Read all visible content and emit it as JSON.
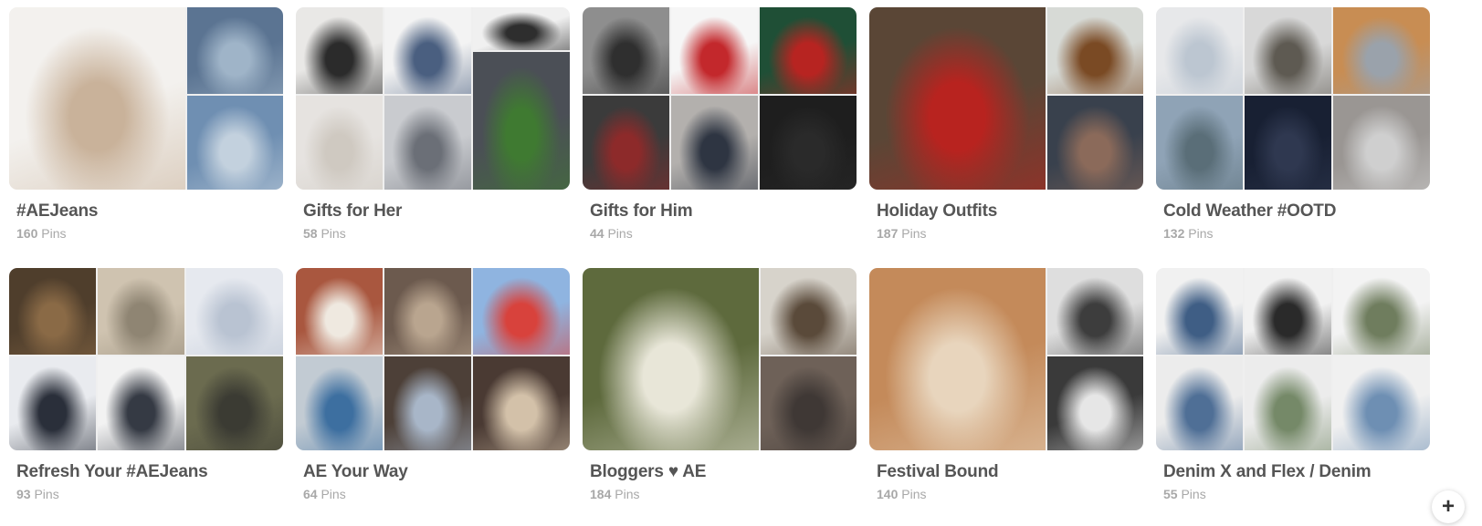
{
  "boards": [
    {
      "title": "#AEJeans",
      "count": "160",
      "unit": "Pins",
      "layout": "big",
      "tiles": [
        [
          "#f3f1ee",
          "#c9b29a"
        ],
        [
          "#5b7492",
          "#9fb4c8"
        ],
        [
          "#6f8fb2",
          "#c3d1de"
        ]
      ]
    },
    {
      "title": "Gifts for Her",
      "count": "58",
      "unit": "Pins",
      "layout": "grid",
      "tiles": [
        [
          "#e9e8e6",
          "#2b2b2b"
        ],
        [
          "#f3f3f3",
          "#4a5f80"
        ],
        [
          "#f0f0f0",
          "#2e2e2e"
        ],
        [
          "#e6e3e0",
          "#cfc9c1"
        ],
        [
          "#c9cbcf",
          "#6b6f77"
        ],
        [
          "#4b4f56",
          "#3f7a31"
        ]
      ]
    },
    {
      "title": "Gifts for Him",
      "count": "44",
      "unit": "Pins",
      "layout": "grid3",
      "tiles": [
        [
          "#8e8e8e",
          "#2f2f2f"
        ],
        [
          "#f6f6f6",
          "#c3282c"
        ],
        [
          "#1f4f36",
          "#b72421"
        ],
        [
          "#3b3b3b",
          "#8d2a2a"
        ],
        [
          "#b3b0ad",
          "#2e3542"
        ],
        [
          "#1e1e1e",
          "#2a2a2a"
        ]
      ]
    },
    {
      "title": "Holiday Outfits",
      "count": "187",
      "unit": "Pins",
      "layout": "big",
      "tiles": [
        [
          "#5a4636",
          "#b8231f"
        ],
        [
          "#d7dad6",
          "#7a4a24"
        ],
        [
          "#39414d",
          "#8b6a5a"
        ]
      ]
    },
    {
      "title": "Cold Weather #OOTD",
      "count": "132",
      "unit": "Pins",
      "layout": "grid3",
      "tiles": [
        [
          "#e7e8ea",
          "#bcc6d1"
        ],
        [
          "#d8d8d8",
          "#5e5a52"
        ],
        [
          "#c88d53",
          "#9aa2ab"
        ],
        [
          "#8fa3b6",
          "#5a6e78"
        ],
        [
          "#182033",
          "#2f3850"
        ],
        [
          "#9a9693",
          "#cfcfcf"
        ]
      ]
    },
    {
      "title": "Refresh Your #AEJeans",
      "count": "93",
      "unit": "Pins",
      "layout": "grid3",
      "tiles": [
        [
          "#4f3e2c",
          "#8a6a46"
        ],
        [
          "#cfc3b0",
          "#8f8573"
        ],
        [
          "#e6e9ef",
          "#b9c3d2"
        ],
        [
          "#e9ebef",
          "#2a2f3a"
        ],
        [
          "#f2f2f2",
          "#353a44"
        ],
        [
          "#6b6b4f",
          "#3b3b33"
        ]
      ]
    },
    {
      "title": "AE Your Way",
      "count": "64",
      "unit": "Pins",
      "layout": "grid3",
      "tiles": [
        [
          "#a9573f",
          "#efe9e0"
        ],
        [
          "#6c5a4e",
          "#b9a58f"
        ],
        [
          "#8fb4e0",
          "#d8423c"
        ],
        [
          "#c2cbd3",
          "#3d6fa0"
        ],
        [
          "#4d4038",
          "#a8b6c8"
        ],
        [
          "#4a3a33",
          "#d3c1a9"
        ]
      ]
    },
    {
      "title": "Bloggers ♥ AE",
      "count": "184",
      "unit": "Pins",
      "layout": "big",
      "tiles": [
        [
          "#5e6a3d",
          "#e8e6d8"
        ],
        [
          "#d7d3cb",
          "#5a4a3a"
        ],
        [
          "#6e6158",
          "#3f3835"
        ]
      ]
    },
    {
      "title": "Festival Bound",
      "count": "140",
      "unit": "Pins",
      "layout": "big",
      "tiles": [
        [
          "#c48a5a",
          "#e8d5bd"
        ],
        [
          "#dedede",
          "#3d3d3d"
        ],
        [
          "#3a3a3a",
          "#e6e6e6"
        ]
      ]
    },
    {
      "title": "Denim X and Flex / Denim",
      "count": "55",
      "unit": "Pins",
      "layout": "grid3",
      "tiles": [
        [
          "#f1f1f1",
          "#3f5e85"
        ],
        [
          "#f1f1f1",
          "#2a2a2a"
        ],
        [
          "#f3f3f3",
          "#6f7d5e"
        ],
        [
          "#ececec",
          "#4f6f96"
        ],
        [
          "#ececec",
          "#758968"
        ],
        [
          "#f0f0f0",
          "#6e8fb3"
        ]
      ]
    }
  ],
  "add_button_glyph": "+"
}
